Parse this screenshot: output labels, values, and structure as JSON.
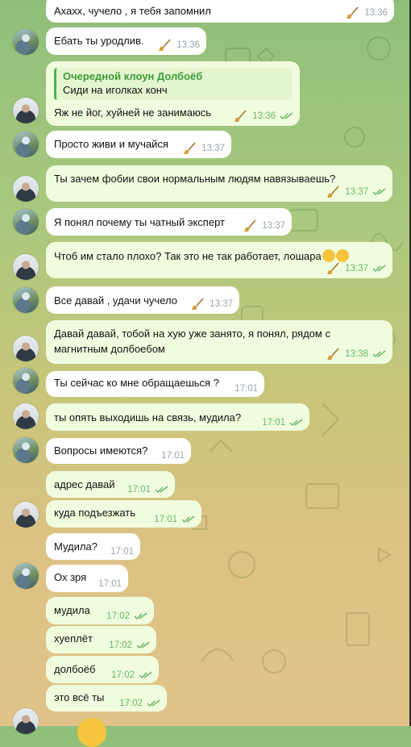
{
  "messages": [
    {
      "from": "in",
      "text": "Ахахх, чучело , я тебя запомнил",
      "time": "13:36",
      "broom": true
    },
    {
      "from": "in",
      "text": "Ебать ты уродлив.",
      "time": "13:36",
      "broom": true
    },
    {
      "from": "out",
      "reply": {
        "name": "Очередной клоун Долбоёб",
        "text": "Сиди на иголках конч"
      },
      "text": "Яж не йог, хуйней не занимаюсь",
      "time": "13:36",
      "broom": true
    },
    {
      "from": "in",
      "text": "Просто живи и мучайся",
      "time": "13:37",
      "broom": true
    },
    {
      "from": "out",
      "text": "Ты зачем фобии свои нормальным людям навязываешь?",
      "time": "13:37",
      "broom": true
    },
    {
      "from": "in",
      "text": "Я понял почему ты чатный эксперт",
      "time": "13:37",
      "broom": true
    },
    {
      "from": "out",
      "text": "Чтоб им стало плохо? Так это не так работает, лошара",
      "emoji": "😂😂",
      "time": "13:37",
      "broom": true
    },
    {
      "from": "in",
      "text": "Все давай , удачи чучело",
      "time": "13:37",
      "broom": true
    },
    {
      "from": "out",
      "text": "Давай давай, тобой на хую уже занято, я понял, рядом с",
      "text2": "магнитным долбоебом",
      "time": "13:38",
      "broom": true
    },
    {
      "from": "in",
      "text": "Ты сейчас ко мне обращаешься ?",
      "time": "17:01"
    },
    {
      "from": "out",
      "text": "ты опять выходишь на связь, мудила?",
      "time": "17:01"
    },
    {
      "from": "in",
      "text": "Вопросы имеются?",
      "time": "17:01"
    },
    {
      "from": "out",
      "text": "адрес давай",
      "time": "17:01"
    },
    {
      "from": "out",
      "text": "куда подъезжать",
      "time": "17:01"
    },
    {
      "from": "in",
      "text": "Мудила?",
      "time": "17:01"
    },
    {
      "from": "in",
      "text": "Ох зря",
      "time": "17:01"
    },
    {
      "from": "out",
      "text": "мудила",
      "time": "17:02"
    },
    {
      "from": "out",
      "text": "хуеплёт",
      "time": "17:02"
    },
    {
      "from": "out",
      "text": "долбоёб",
      "time": "17:02"
    },
    {
      "from": "out",
      "text": "это всё ты",
      "time": "17:02"
    }
  ],
  "colors": {
    "incoming": "#ffffff",
    "outgoing": "#effdde",
    "reply_accent": "#4caf50",
    "check": "#6bb56a"
  },
  "icons": {
    "read": "double-check-icon",
    "broom": "broom-icon",
    "avatar_in": "avatar-landscape",
    "avatar_out": "avatar-person"
  }
}
